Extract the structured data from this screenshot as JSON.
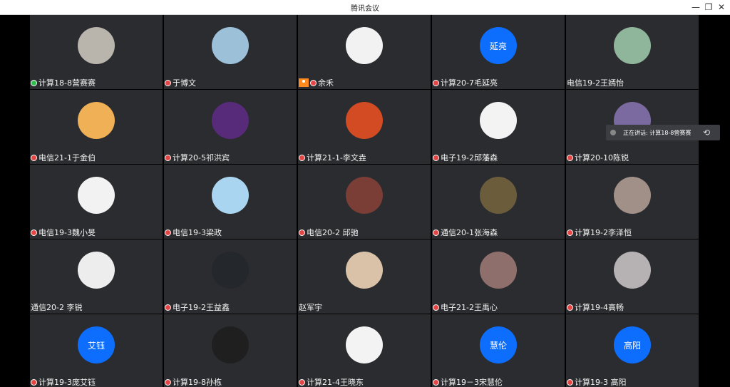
{
  "window": {
    "title": "腾讯会议",
    "controls": {
      "minimize": "—",
      "restore": "❐",
      "close": "✕"
    }
  },
  "speaker_notice": "正在讲话: 计算18-8营赛赛",
  "participants": [
    {
      "name": "计算18-8营赛赛",
      "avatar_color": "#b9b5ad",
      "avatar_text": "",
      "mic": "on"
    },
    {
      "name": "于博文",
      "avatar_color": "#9bc0d8",
      "avatar_text": "",
      "mic": "off"
    },
    {
      "name": "余禾",
      "avatar_color": "#f2f2f2",
      "avatar_text": "",
      "mic": "off",
      "user_icon": true
    },
    {
      "name": "计算20-7毛延亮",
      "avatar_color": "#0d6efd",
      "avatar_text": "延亮",
      "mic": "off"
    },
    {
      "name": "电信19-2王嫣怡",
      "avatar_color": "#8fb59b",
      "avatar_text": "",
      "mic": "none"
    },
    {
      "name": "电信21-1于金伯",
      "avatar_color": "#f0b055",
      "avatar_text": "",
      "mic": "off"
    },
    {
      "name": "计算20-5祁洪宾",
      "avatar_color": "#582a7a",
      "avatar_text": "",
      "mic": "off"
    },
    {
      "name": "计算21-1-李文垚",
      "avatar_color": "#d24b22",
      "avatar_text": "",
      "mic": "off"
    },
    {
      "name": "电子19-2邱藩森",
      "avatar_color": "#f3f3f3",
      "avatar_text": "",
      "mic": "off"
    },
    {
      "name": "计算20-10陈锐",
      "avatar_color": "#7b6aa0",
      "avatar_text": "",
      "mic": "off"
    },
    {
      "name": "电信19-3魏小旻",
      "avatar_color": "#f2f2f2",
      "avatar_text": "",
      "mic": "off"
    },
    {
      "name": "电信19-3梁政",
      "avatar_color": "#a9d5f0",
      "avatar_text": "",
      "mic": "off"
    },
    {
      "name": "电信20-2 邱驰",
      "avatar_color": "#7a3e36",
      "avatar_text": "",
      "mic": "off"
    },
    {
      "name": "通信20-1张海森",
      "avatar_color": "#6b5c3c",
      "avatar_text": "",
      "mic": "off"
    },
    {
      "name": "计算19-2李泽恒",
      "avatar_color": "#a19088",
      "avatar_text": "",
      "mic": "off"
    },
    {
      "name": "通信20-2 李锐",
      "avatar_color": "#ededed",
      "avatar_text": "",
      "mic": "none"
    },
    {
      "name": "电子19-2王益鑫",
      "avatar_color": "#24272c",
      "avatar_text": "",
      "mic": "off"
    },
    {
      "name": "赵军宇",
      "avatar_color": "#d9c2a8",
      "avatar_text": "",
      "mic": "none"
    },
    {
      "name": "电子21-2王禹心",
      "avatar_color": "#8f6f6c",
      "avatar_text": "",
      "mic": "off"
    },
    {
      "name": "计算19-4高畅",
      "avatar_color": "#b6b1b3",
      "avatar_text": "",
      "mic": "off"
    },
    {
      "name": "计算19-3庞艾钰",
      "avatar_color": "#0d6efd",
      "avatar_text": "艾钰",
      "mic": "off"
    },
    {
      "name": "计算19-8孙栋",
      "avatar_color": "#1f1f1f",
      "avatar_text": "",
      "mic": "off"
    },
    {
      "name": "计算21-4王晓东",
      "avatar_color": "#f3f3f3",
      "avatar_text": "",
      "mic": "off"
    },
    {
      "name": "计算19－3宋慧伦",
      "avatar_color": "#0d6efd",
      "avatar_text": "慧伦",
      "mic": "off"
    },
    {
      "name": "计算19-3 高阳",
      "avatar_color": "#0d6efd",
      "avatar_text": "高阳",
      "mic": "off"
    }
  ]
}
